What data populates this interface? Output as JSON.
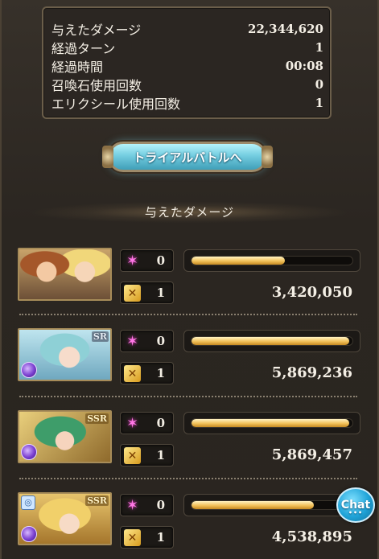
{
  "stats": {
    "rows": [
      {
        "label": "与えたダメージ",
        "value": "22,344,620"
      },
      {
        "label": "経過ターン",
        "value": "1"
      },
      {
        "label": "経過時間",
        "value": "00:08"
      },
      {
        "label": "召喚石使用回数",
        "value": "0"
      },
      {
        "label": "エリクシール使用回数",
        "value": "1"
      }
    ]
  },
  "trial_button": {
    "label": "トライアルバトルへ"
  },
  "section_heading": "与えたダメージ",
  "characters": [
    {
      "rarity": "",
      "element": "",
      "ability_count": "0",
      "ca_count": "1",
      "damage": "3,420,050",
      "ougi_gauge_percent": 58
    },
    {
      "rarity": "SR",
      "element": "dark",
      "ability_count": "0",
      "ca_count": "1",
      "damage": "5,869,236",
      "ougi_gauge_percent": 98
    },
    {
      "rarity": "SSR",
      "element": "dark",
      "ability_count": "0",
      "ca_count": "1",
      "damage": "5,869,457",
      "ougi_gauge_percent": 98
    },
    {
      "rarity": "SSR",
      "element": "dark",
      "ability_count": "0",
      "ca_count": "1",
      "damage": "4,538,895",
      "ougi_gauge_percent": 76
    }
  ],
  "icons": {
    "ability": "sparkle-icon",
    "charge_attack": "charge-attack-icon",
    "element": "dark-element-icon",
    "ring": "ring-icon"
  },
  "chat": {
    "label": "Chat",
    "dots": "•••"
  },
  "colors": {
    "accent_gold": "#f2c15a",
    "button_cyan": "#74cde0",
    "panel_border": "#6b5e4a",
    "chat_blue": "#1fa3d8"
  }
}
